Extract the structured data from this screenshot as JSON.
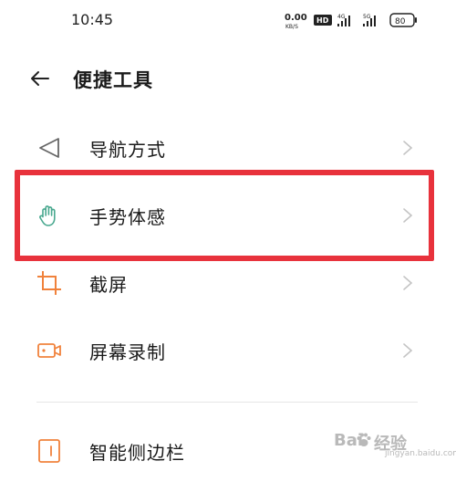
{
  "status_bar": {
    "time": "10:45",
    "net_speed_value": "0.00",
    "net_speed_unit": "KB/S",
    "hd_badge": "HD",
    "sim1_label": "4G",
    "sim2_label": "5G",
    "battery": "80"
  },
  "header": {
    "back_icon": "arrow-left-icon",
    "title": "便捷工具"
  },
  "menu": {
    "items": [
      {
        "label": "导航方式",
        "icon": "navigation-triangle-icon"
      },
      {
        "label": "手势体感",
        "icon": "hand-icon"
      },
      {
        "label": "截屏",
        "icon": "crop-icon"
      },
      {
        "label": "屏幕录制",
        "icon": "video-camera-icon"
      },
      {
        "label": "智能侧边栏",
        "icon": "sidebar-panel-icon"
      }
    ]
  },
  "highlight": {
    "color": "#e8323c"
  },
  "colors": {
    "accent_green": "#49a88f",
    "accent_orange": "#f0823c"
  },
  "watermark": {
    "left_text": "Bai",
    "right_text": "经验",
    "sub_text": "jingyan.baidu.com"
  }
}
